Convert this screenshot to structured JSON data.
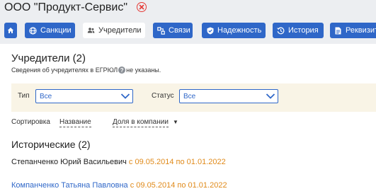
{
  "company": {
    "title": "ООО \"Продукт-Сервис\""
  },
  "nav": {
    "tabs": [
      {
        "label": "",
        "icon": "home-icon"
      },
      {
        "label": "Санкции",
        "icon": "globe-icon"
      },
      {
        "label": "Учредители",
        "icon": "users-icon",
        "active": true
      },
      {
        "label": "Связи",
        "icon": "link-icon"
      },
      {
        "label": "Надежность",
        "icon": "shield-icon"
      },
      {
        "label": "История",
        "icon": "history-icon"
      },
      {
        "label": "Реквизиты",
        "icon": "document-icon"
      }
    ]
  },
  "page": {
    "title": "Учредители (2)",
    "subtitle_before": "Сведения об учредителях в ЕГРЮЛ",
    "subtitle_after": "не указаны."
  },
  "filters": {
    "type_label": "Тип",
    "type_value": "Все",
    "status_label": "Статус",
    "status_value": "Все"
  },
  "sort": {
    "label": "Сортировка",
    "by_name": "Название",
    "by_share": "Доля в компании",
    "caret": "▼"
  },
  "historical": {
    "title": "Исторические (2)",
    "items": [
      {
        "name": "Степанченко Юрий Васильевич",
        "dates": "с 09.05.2014 по 01.01.2022",
        "is_link": false
      },
      {
        "name": "Компанченко Татьяна Павловна",
        "dates": "с 09.05.2014 по 01.01.2022",
        "is_link": true
      }
    ]
  },
  "colors": {
    "accent": "#2f67c8",
    "date": "#e08a1a",
    "close": "#e53935",
    "filter_bg": "#f9f4e6"
  }
}
